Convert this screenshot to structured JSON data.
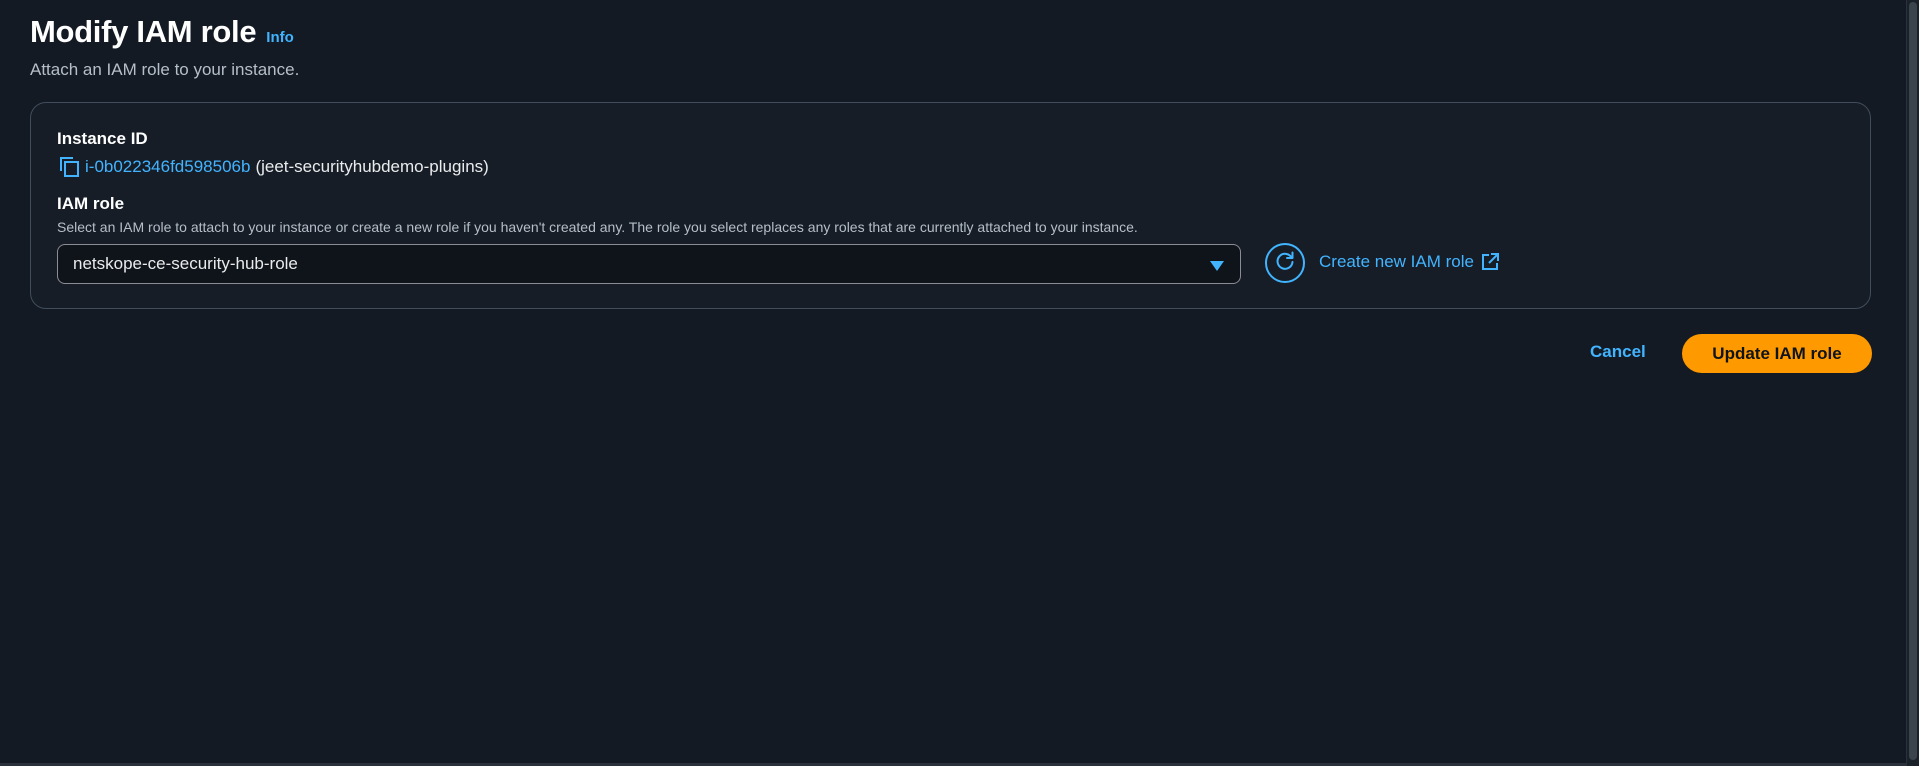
{
  "header": {
    "title": "Modify IAM role",
    "info_label": "Info",
    "subtitle": "Attach an IAM role to your instance."
  },
  "instance": {
    "label": "Instance ID",
    "id": "i-0b022346fd598506b",
    "name": "(jeet-securityhubdemo-plugins)"
  },
  "iam_role": {
    "label": "IAM role",
    "description": "Select an IAM role to attach to your instance or create a new role if you haven't created any. The role you select replaces any roles that are currently attached to your instance.",
    "selected_value": "netskope-ce-security-hub-role",
    "create_link": "Create new IAM role"
  },
  "actions": {
    "cancel_label": "Cancel",
    "update_label": "Update IAM role"
  },
  "icons": {
    "copy": "copy-icon",
    "caret": "caret-down-icon",
    "refresh": "refresh-icon",
    "external": "external-link-icon"
  },
  "colors": {
    "background": "#131a23",
    "link": "#42b4ff",
    "primary_button": "#ff9900",
    "card_border": "#414d5c"
  }
}
